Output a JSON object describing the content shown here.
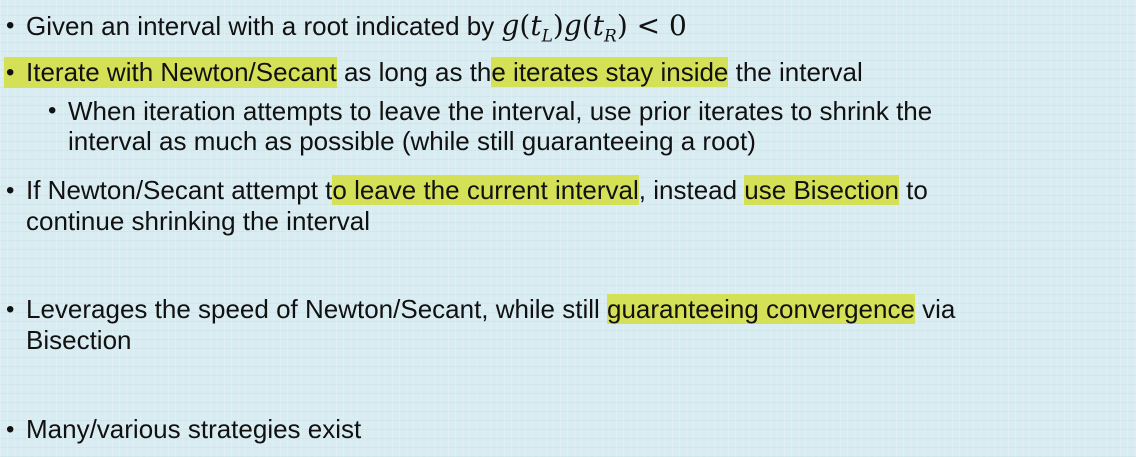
{
  "slide": {
    "b1": {
      "text": "Given an interval with a root indicated by ",
      "math": {
        "g1": "g",
        "t1": "t",
        "sub1": "L",
        "g2": "g",
        "t2": "t",
        "sub2": "R",
        "rel": " < 0"
      }
    },
    "b2": {
      "hl1": "Iterate with Newton/Secant",
      "mid1": " as long as th",
      "hl2": "e iterates stay inside",
      "tail": " the interval"
    },
    "b2_sub": {
      "line1": "When iteration attempts to leave the interval, use prior iterates to shrink the",
      "line2": "interval as much as possible (while still guaranteeing a root)"
    },
    "b3": {
      "pre": "If Newton/Secant attempt t",
      "hl1": "o leave the current interval",
      "mid": ", instead ",
      "hl2": "use Bisection",
      "tail": " to",
      "line2": "continue shrinking the interval"
    },
    "b4": {
      "pre": "Leverages the speed of Newton/Secant, while still ",
      "hl": "guaranteeing convergence",
      "tail": " via",
      "line2": "Bisection"
    },
    "b5": {
      "text": "Many/various strategies exist"
    },
    "bullet_symbol": "•",
    "highlight_color": "#d4e157",
    "background_color": "#d9ecf2"
  }
}
